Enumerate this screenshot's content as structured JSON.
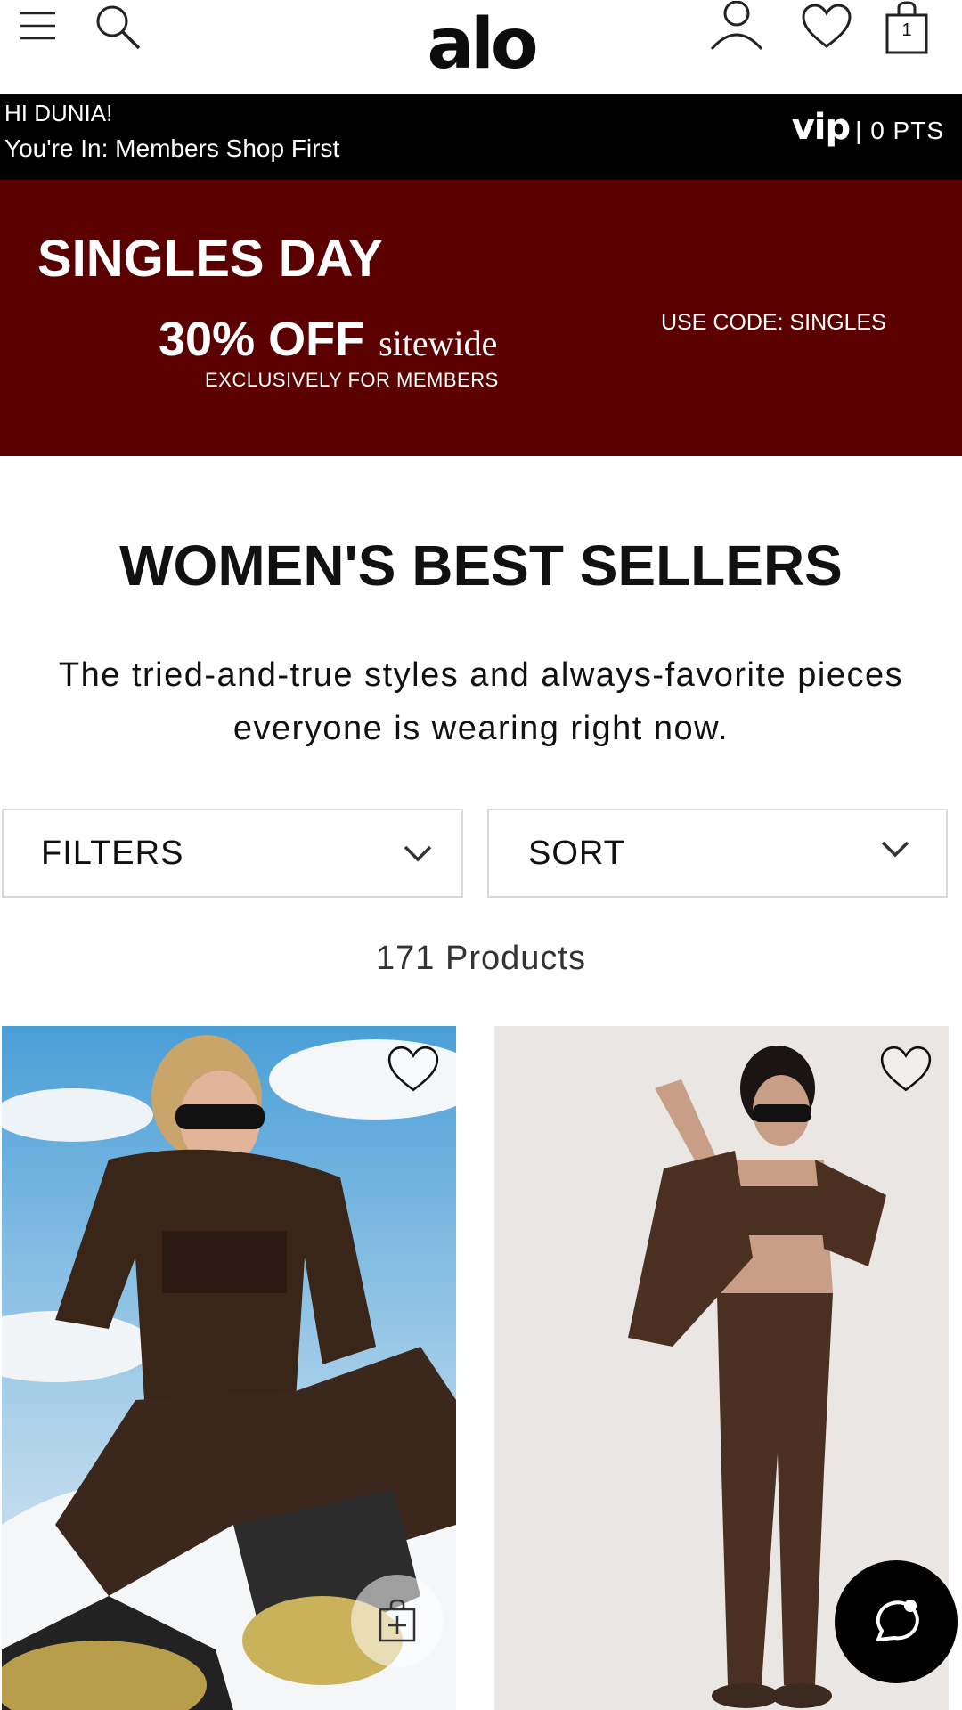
{
  "header": {
    "logo_text": "alo",
    "cart_count": "1",
    "icons": [
      "menu-icon",
      "search-icon",
      "account-icon",
      "wishlist-icon",
      "shopping-bag-icon"
    ]
  },
  "member_bar": {
    "greeting": "HI DUNIA!",
    "status": "You're In: Members Shop First",
    "vip_label": "vip",
    "points": "| 0 PTS"
  },
  "promo": {
    "title": "SINGLES DAY",
    "discount": "30% OFF",
    "discount_suffix": "sitewide",
    "subtitle": "EXCLUSIVELY FOR MEMBERS",
    "code": "USE CODE: SINGLES",
    "background": "#5a0000"
  },
  "collection": {
    "title": "WOMEN'S BEST SELLERS",
    "description": "The tried-and-true styles and always-favorite pieces everyone is wearing right now.",
    "product_count": "171 Products"
  },
  "controls": {
    "filters_label": "FILTERS",
    "sort_label": "SORT"
  },
  "products": [
    {
      "image": "model in brown puffer jacket, sunglasses and leggings sitting in snow"
    },
    {
      "image": "model in brown bra top and leggings holding brown sweatshirt"
    }
  ]
}
